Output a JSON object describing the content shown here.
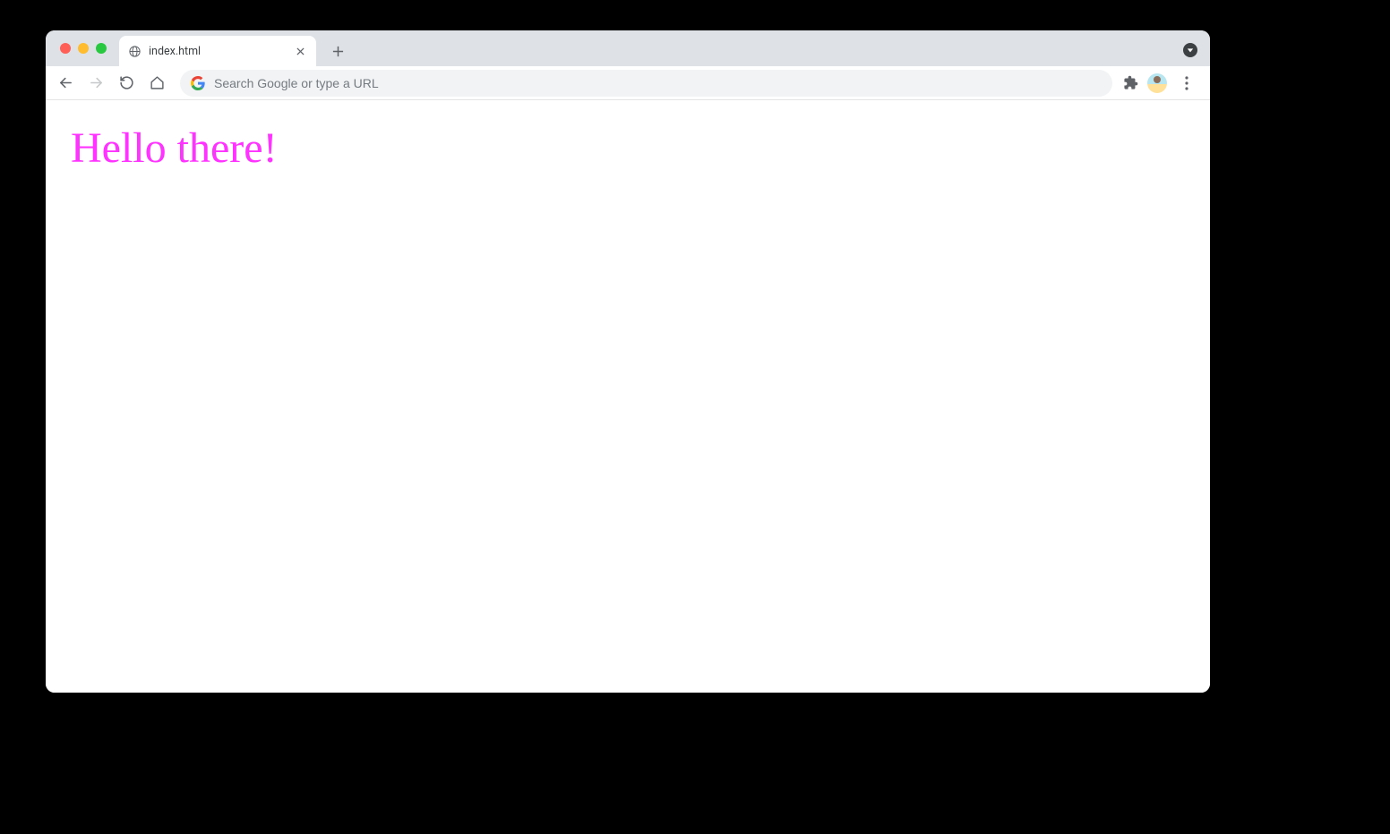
{
  "tab": {
    "title": "index.html"
  },
  "address_bar": {
    "placeholder": "Search Google or type a URL",
    "value": ""
  },
  "page": {
    "heading": "Hello there!"
  },
  "colors": {
    "heading": "#ff33ff",
    "tab_strip": "#dee1e6",
    "address_bg": "#f1f3f4"
  }
}
